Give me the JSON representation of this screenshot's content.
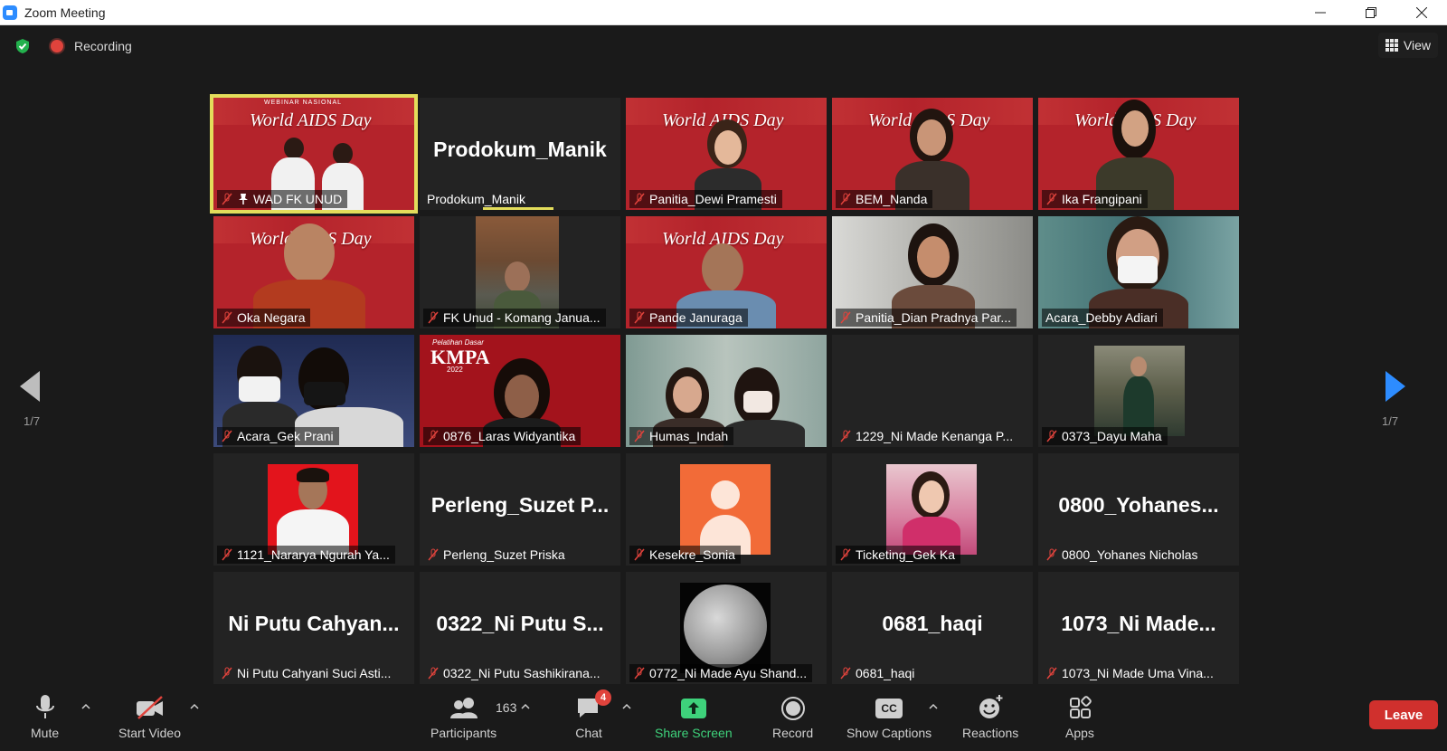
{
  "window": {
    "title": "Zoom Meeting"
  },
  "topbar": {
    "recording_label": "Recording",
    "view_label": "View"
  },
  "navigation": {
    "left_page": "1/7",
    "right_page": "1/7"
  },
  "banner": {
    "title": "World AIDS Day",
    "subtitle": "WEBINAR NASIONAL"
  },
  "kmpa": {
    "title": "KMPA",
    "subtitle": "Pelatihan Dasar",
    "year": "2022"
  },
  "tiles": [
    {
      "name": "WAD FK UNUD",
      "big": ""
    },
    {
      "name": "Prodokum_Manik",
      "big": "Prodokum_Manik"
    },
    {
      "name": "Panitia_Dewi Pramesti",
      "big": ""
    },
    {
      "name": "BEM_Nanda",
      "big": ""
    },
    {
      "name": "Ika Frangipani",
      "big": ""
    },
    {
      "name": "Oka Negara",
      "big": ""
    },
    {
      "name": "FK Unud - Komang Janua...",
      "big": ""
    },
    {
      "name": "Pande Januraga",
      "big": ""
    },
    {
      "name": "Panitia_Dian Pradnya Par...",
      "big": ""
    },
    {
      "name": "Acara_Debby Adiari",
      "big": ""
    },
    {
      "name": "Acara_Gek Prani",
      "big": ""
    },
    {
      "name": "0876_Laras Widyantika",
      "big": ""
    },
    {
      "name": "Humas_Indah",
      "big": ""
    },
    {
      "name": "1229_Ni Made Kenanga P...",
      "big": ""
    },
    {
      "name": "0373_Dayu Maha",
      "big": ""
    },
    {
      "name": "1121_Nararya Ngurah Ya...",
      "big": ""
    },
    {
      "name": "Perleng_Suzet Priska",
      "big": "Perleng_Suzet P..."
    },
    {
      "name": "Kesekre_Sonia",
      "big": ""
    },
    {
      "name": "Ticketing_Gek Ka",
      "big": ""
    },
    {
      "name": "0800_Yohanes Nicholas",
      "big": "0800_Yohanes..."
    },
    {
      "name": "Ni Putu Cahyani Suci Asti...",
      "big": "Ni Putu Cahyan..."
    },
    {
      "name": "0322_Ni Putu Sashikirana...",
      "big": "0322_Ni Putu S..."
    },
    {
      "name": "0772_Ni Made Ayu Shand...",
      "big": ""
    },
    {
      "name": "0681_haqi",
      "big": "0681_haqi"
    },
    {
      "name": "1073_Ni Made Uma Vina...",
      "big": "1073_Ni Made..."
    }
  ],
  "toolbar": {
    "mute": "Mute",
    "start_video": "Start Video",
    "participants": "Participants",
    "participants_count": "163",
    "chat": "Chat",
    "chat_badge": "4",
    "share_screen": "Share Screen",
    "record": "Record",
    "show_captions": "Show Captions",
    "captions_icon_text": "CC",
    "reactions": "Reactions",
    "apps": "Apps",
    "leave": "Leave"
  },
  "colors": {
    "accent_green": "#3ed27b",
    "leave_red": "#d0302d",
    "active_speaker": "#e3dd5b",
    "banner_red": "#b4232b"
  }
}
